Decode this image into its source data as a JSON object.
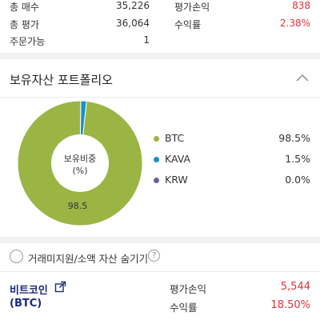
{
  "summary": {
    "rows": [
      {
        "label": "총 매수",
        "value": "35,226",
        "label2": "평가손익",
        "value2": "838"
      },
      {
        "label": "총 평가",
        "value": "36,064",
        "label2": "수익률",
        "value2": "2.38%"
      },
      {
        "label": "주문가능",
        "value": "1"
      }
    ],
    "profit_color": "#e0303c"
  },
  "portfolio": {
    "title": "보유자산 포트폴리오",
    "toggle_icon": "chevron-up-icon",
    "center_label_line1": "보유비중",
    "center_label_line2": "(%)",
    "slice_label": "98.5",
    "legend": [
      {
        "name": "BTC",
        "value": "98.5%",
        "color": "#9bb545"
      },
      {
        "name": "KAVA",
        "value": "1.5%",
        "color": "#1a8fc9"
      },
      {
        "name": "KRW",
        "value": "0.0%",
        "color": "#6b5ea8"
      }
    ]
  },
  "chart_data": {
    "type": "pie",
    "categories": [
      "BTC",
      "KAVA",
      "KRW"
    ],
    "values": [
      98.5,
      1.5,
      0.0
    ],
    "colors": [
      "#9bb545",
      "#1a8fc9",
      "#6b5ea8"
    ],
    "title": "",
    "data_labels": [
      "98.5"
    ],
    "legend_position": "right"
  },
  "hide_option": {
    "label": "거래미지원/소액 자산 숨기기",
    "help_icon": "question-icon",
    "help_glyph": "?"
  },
  "holding": {
    "name": "비트코인",
    "code": "(BTC)",
    "link_icon": "share-icon",
    "profit_label": "평가손익",
    "profit_value": "5,544",
    "rate_label": "수익률",
    "rate_value": "18.50%"
  }
}
